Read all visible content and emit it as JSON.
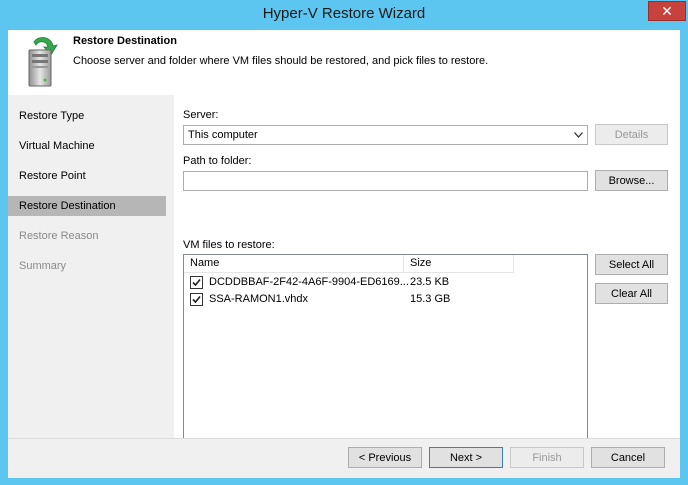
{
  "window": {
    "title": "Hyper-V Restore Wizard",
    "close_glyph": "✕"
  },
  "header": {
    "title": "Restore Destination",
    "subtitle": "Choose server and folder where VM files should be restored, and pick files to restore.",
    "icon": "server-restore-icon"
  },
  "steps": [
    {
      "label": "Restore Type",
      "state": "done"
    },
    {
      "label": "Virtual Machine",
      "state": "done"
    },
    {
      "label": "Restore Point",
      "state": "done"
    },
    {
      "label": "Restore Destination",
      "state": "active"
    },
    {
      "label": "Restore Reason",
      "state": "disabled"
    },
    {
      "label": "Summary",
      "state": "disabled"
    }
  ],
  "form": {
    "server_label": "Server:",
    "server_value": "This computer",
    "details_label": "Details",
    "path_label": "Path to folder:",
    "path_value": "",
    "browse_label": "Browse...",
    "files_label": "VM files to restore:",
    "select_all_label": "Select All",
    "clear_all_label": "Clear All"
  },
  "file_table": {
    "columns": [
      "Name",
      "Size"
    ],
    "rows": [
      {
        "checked": true,
        "name": "DCDDBBAF-2F42-4A6F-9904-ED6169...",
        "size": "23.5 KB"
      },
      {
        "checked": true,
        "name": "SSA-RAMON1.vhdx",
        "size": "15.3 GB"
      }
    ]
  },
  "footer": {
    "previous_label": "< Previous",
    "next_label": "Next >",
    "finish_label": "Finish",
    "cancel_label": "Cancel"
  }
}
